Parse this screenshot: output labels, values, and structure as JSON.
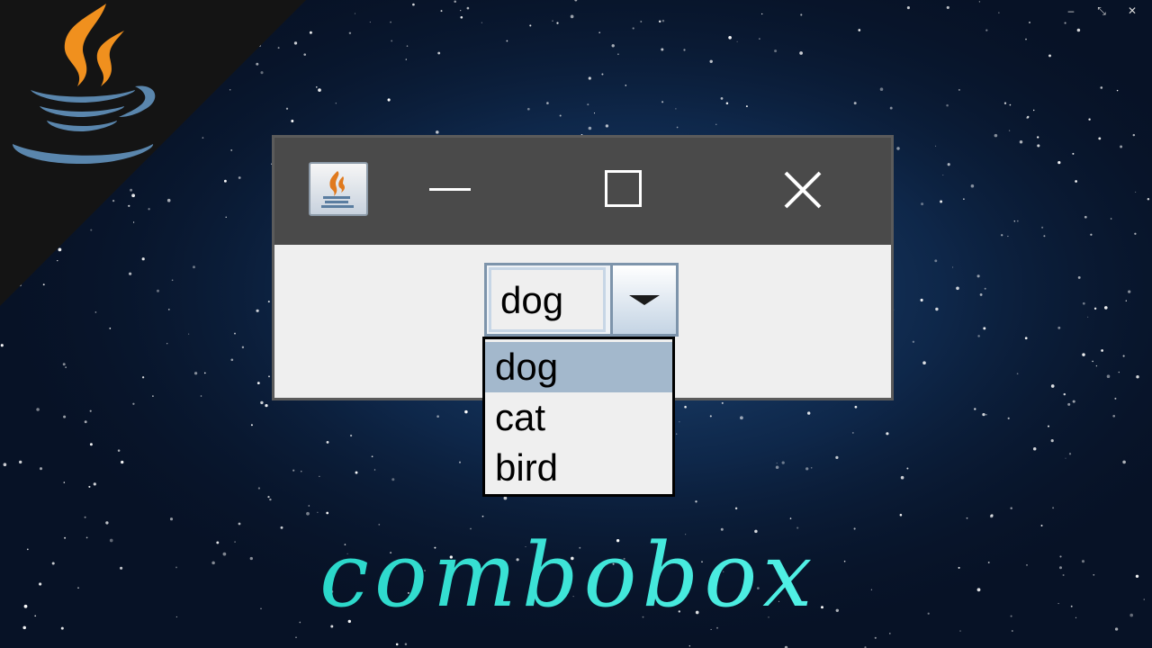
{
  "window": {
    "title_icon": "java-cup-icon",
    "controls": [
      "minimize-icon",
      "maximize-icon",
      "close-icon"
    ]
  },
  "screen_controls": [
    "–",
    "⤡",
    "✕"
  ],
  "combobox": {
    "selected_value": "dog",
    "options": [
      "dog",
      "cat",
      "bird"
    ],
    "highlighted_index": 0
  },
  "caption": "combobox",
  "colors": {
    "titlebar": "#4a4a4a",
    "window_bg": "#efefef",
    "selection": "#a3b8cc",
    "caption": "#3ee8d8",
    "java_orange": "#f0901e",
    "java_blue": "#5a86ad"
  }
}
